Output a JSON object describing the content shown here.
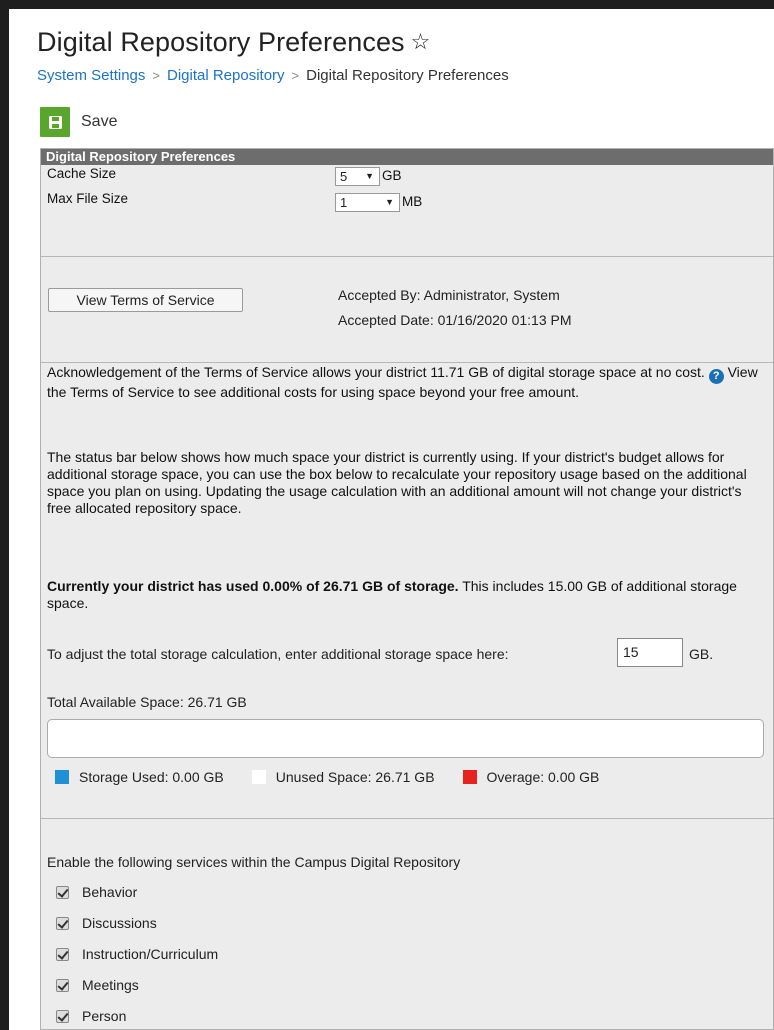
{
  "header": {
    "title": "Digital Repository Preferences",
    "star": "☆",
    "breadcrumb": [
      "System Settings",
      "Digital Repository",
      "Digital Repository Preferences"
    ],
    "separator": ">"
  },
  "toolbar": {
    "save_label": "Save"
  },
  "panel": {
    "header": "Digital Repository Preferences",
    "cache_size_label": "Cache Size",
    "cache_size_value": "5",
    "cache_size_unit": "GB",
    "max_file_size_label": "Max File Size",
    "max_file_size_value": "1",
    "max_file_size_unit": "MB",
    "view_terms_button": "View Terms of Service",
    "accepted_by": "Accepted By: Administrator, System",
    "accepted_date": "Accepted Date: 01/16/2020 01:13 PM",
    "ack_text_1": "Acknowledgement of the Terms of Service allows your district 11.71 GB of digital storage space at no cost.",
    "ack_text_2": "View the Terms of Service to see additional costs for using space beyond your free amount.",
    "status_text": "The status bar below shows how much space your district is currently using. If your district's budget allows for additional storage space, you can use the box below to recalculate your repository usage based on the additional space you plan on using. Updating the usage calculation with an additional amount will not change your district's free allocated repository space.",
    "usage_bold": "Currently your district has used 0.00% of 26.71 GB of storage.",
    "usage_rest": " This includes 15.00 GB of additional storage space.",
    "adjust_label": "To adjust the total storage calculation, enter additional storage space here:",
    "adjust_value": "15",
    "adjust_unit": "GB.",
    "total_available": "Total Available Space: 26.71 GB",
    "storage_used_fraction": 0,
    "legend": {
      "used": "Storage Used: 0.00 GB",
      "unused": "Unused Space: 26.71 GB",
      "overage": "Overage: 0.00 GB"
    },
    "services_label": "Enable the following services within the Campus Digital Repository",
    "services": [
      "Behavior",
      "Discussions",
      "Instruction/Curriculum",
      "Meetings",
      "Person"
    ]
  },
  "colors": {
    "used": "#1e90d6",
    "unused": "#ffffff",
    "overage": "#e8231e",
    "save": "#5aa62d",
    "link": "#1a73c8"
  }
}
